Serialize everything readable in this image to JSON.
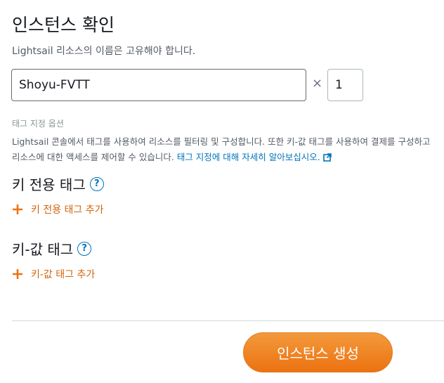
{
  "header": {
    "title": "인스턴스 확인",
    "subtitle": "Lightsail 리소스의 이름은 고유해야 합니다."
  },
  "instance": {
    "name_value": "Shoyu-FVTT",
    "times_symbol": "×",
    "count_value": "1"
  },
  "tags": {
    "options_label": "태그 지정 옵션",
    "description": "Lightsail 콘솔에서 태그를 사용하여 리소스를 필터링 및 구성합니다. 또한 키-값 태그를 사용하여 결제를 구성하고 리소스에 대한 액세스를 제어할 수 있습니다.",
    "learn_more_link": "태그 지정에 대해 자세히 알아보십시오.",
    "key_only": {
      "title": "키 전용 태그",
      "help": "?",
      "add_label": "키 전용 태그 추가"
    },
    "key_value": {
      "title": "키-값 태그",
      "help": "?",
      "add_label": "키-값 태그 추가"
    }
  },
  "footer": {
    "create_button": "인스턴스 생성"
  },
  "colors": {
    "accent_orange": "#ec7211",
    "link_blue": "#0073bb"
  }
}
